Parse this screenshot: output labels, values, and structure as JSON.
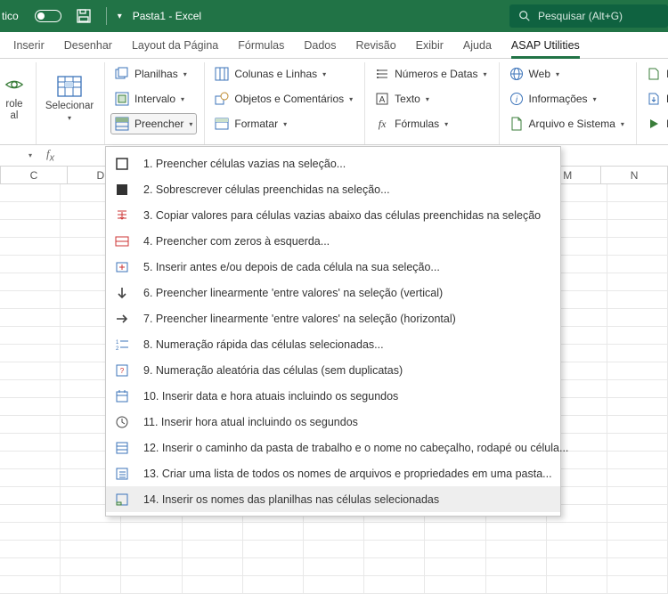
{
  "title": "Pasta1 - Excel",
  "search_placeholder": "Pesquisar (Alt+G)",
  "tabs": [
    "Inserir",
    "Desenhar",
    "Layout da Página",
    "Fórmulas",
    "Dados",
    "Revisão",
    "Exibir",
    "Ajuda",
    "ASAP Utilities"
  ],
  "active_tab": 8,
  "big_left": {
    "label1": "role",
    "label2": "al"
  },
  "big_select": "Selecionar",
  "col1": {
    "a": "Planilhas",
    "b": "Intervalo",
    "c": "Preencher"
  },
  "col2": {
    "a": "Colunas e Linhas",
    "b": "Objetos e Comentários",
    "c": "Formatar"
  },
  "col3": {
    "a": "Números e Datas",
    "b": "Texto",
    "c": "Fórmulas"
  },
  "col4": {
    "a": "Web",
    "b": "Informações",
    "c": "Arquivo e Sistema"
  },
  "col5": {
    "a": "Impo",
    "b": "Expo",
    "c": "Inicia"
  },
  "columns": [
    "C",
    "D",
    "",
    "",
    "",
    "",
    "",
    "",
    "M",
    "N"
  ],
  "menu": [
    "1.  Preencher células vazias na seleção...",
    "2.  Sobrescrever células preenchidas na seleção...",
    "3.  Copiar valores para células vazias abaixo das células preenchidas na seleção",
    "4.  Preencher com zeros à esquerda...",
    "5.  Inserir antes e/ou depois de cada célula na sua seleção...",
    "6.  Preencher linearmente 'entre valores' na seleção (vertical)",
    "7.  Preencher linearmente 'entre valores' na seleção (horizontal)",
    "8.  Numeração rápida das células selecionadas...",
    "9.  Numeração aleatória das células (sem duplicatas)",
    "10.  Inserir data e hora atuais incluindo os segundos",
    "11.  Inserir hora atual incluindo os segundos",
    "12.  Inserir o caminho da pasta de trabalho e o nome no cabeçalho, rodapé ou célula...",
    "13.  Criar uma lista de todos os nomes de arquivos e propriedades em uma pasta...",
    "14.  Inserir os nomes das planilhas nas células selecionadas"
  ]
}
